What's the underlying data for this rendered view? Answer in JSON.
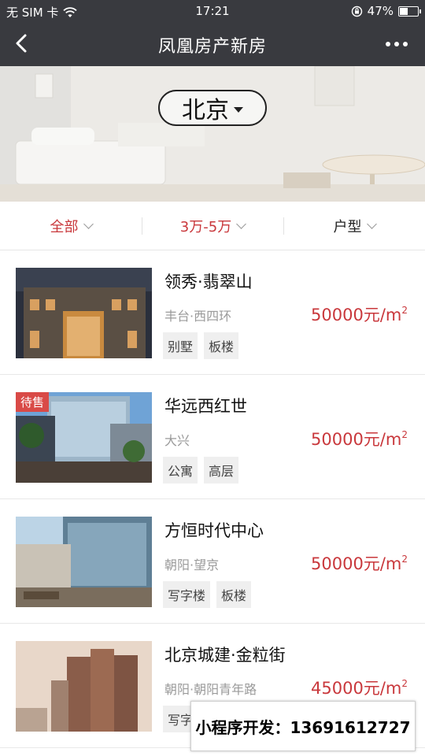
{
  "status_bar": {
    "carrier": "无 SIM 卡",
    "time": "17:21",
    "battery": "47%",
    "battery_level": 0.47
  },
  "nav": {
    "title": "凤凰房产新房"
  },
  "hero": {
    "city": "北京"
  },
  "filters": [
    {
      "label": "全部",
      "active": true
    },
    {
      "label": "3万-5万",
      "active": true
    },
    {
      "label": "户型",
      "active": false
    }
  ],
  "listings": [
    {
      "name": "领秀·翡翠山",
      "district": "丰台·西四环",
      "price": "50000元/m",
      "price_unit_sup": "2",
      "tags": [
        "别墅",
        "板楼"
      ],
      "badge": ""
    },
    {
      "name": "华远西红世",
      "district": "大兴",
      "price": "50000元/m",
      "price_unit_sup": "2",
      "tags": [
        "公寓",
        "高层"
      ],
      "badge": "待售"
    },
    {
      "name": "方恒时代中心",
      "district": "朝阳·望京",
      "price": "50000元/m",
      "price_unit_sup": "2",
      "tags": [
        "写字楼",
        "板楼"
      ],
      "badge": ""
    },
    {
      "name": "北京城建·金粒街",
      "district": "朝阳·朝阳青年路",
      "price": "45000元/m",
      "price_unit_sup": "2",
      "tags": [
        "写字楼"
      ],
      "badge": ""
    }
  ],
  "promo": {
    "text": "小程序开发：13691612727"
  },
  "colors": {
    "nav_bg": "#393a3f",
    "accent_red": "#c9383c",
    "badge_red": "#d94a47"
  }
}
